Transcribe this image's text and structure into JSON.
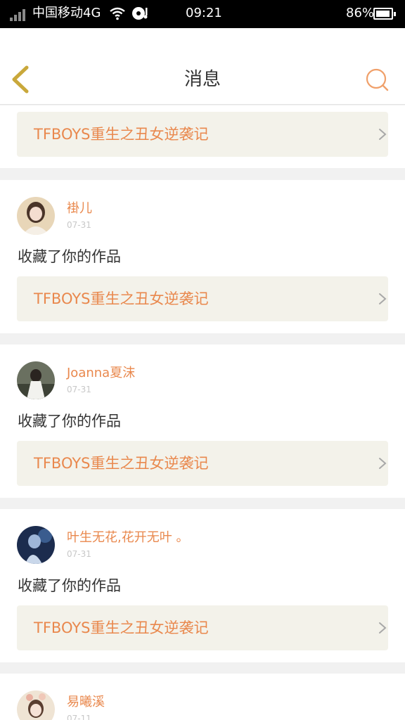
{
  "status_bar": {
    "carrier": "中国移动4G",
    "time": "09:21",
    "battery": "86%",
    "battery_level": 0.86
  },
  "header": {
    "title": "消息"
  },
  "story_title": "TFBOYS重生之丑女逆袭记",
  "messages": [
    {
      "user": "",
      "date": "",
      "action": "",
      "story": "TFBOYS重生之丑女逆袭记"
    },
    {
      "user": "褂儿",
      "date": "07-31",
      "action": "收藏了你的作品",
      "story": "TFBOYS重生之丑女逆袭记"
    },
    {
      "user": "Joanna夏沫",
      "date": "07-31",
      "action": "收藏了你的作品",
      "story": "TFBOYS重生之丑女逆袭记"
    },
    {
      "user": "叶生无花,花开无叶 。",
      "date": "07-31",
      "action": "收藏了你的作品",
      "story": "TFBOYS重生之丑女逆袭记"
    },
    {
      "user": "易曦溪",
      "date": "07-11",
      "action": "",
      "story": ""
    }
  ],
  "colors": {
    "accent": "#e9884d",
    "card_bg": "#f3f2ea",
    "back_arrow": "#c9a83b"
  },
  "icons": {
    "back": "chevron-left-icon",
    "search": "search-icon",
    "detail": "chevron-right-icon"
  }
}
